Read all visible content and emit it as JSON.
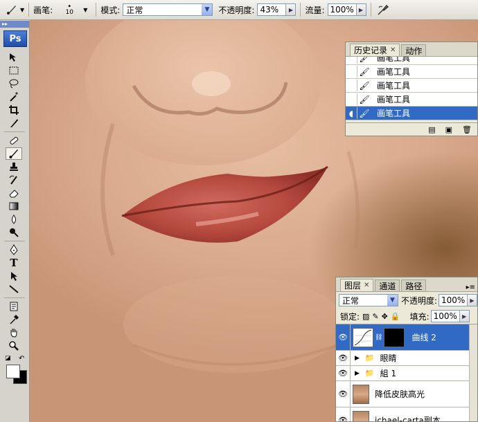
{
  "options_bar": {
    "brush_label": "画笔:",
    "brush_size": "10",
    "mode_label": "模式:",
    "mode_value": "正常",
    "opacity_label": "不透明度:",
    "opacity_value": "43%",
    "flow_label": "流量:",
    "flow_value": "100%"
  },
  "toolbox": {
    "logo": "Ps",
    "text_tool": "T"
  },
  "history_panel": {
    "tabs": [
      "历史记录",
      "动作"
    ],
    "items": [
      {
        "label": "画笔工具",
        "selected": false
      },
      {
        "label": "画笔工具",
        "selected": false
      },
      {
        "label": "画笔工具",
        "selected": false
      },
      {
        "label": "画笔工具",
        "selected": false
      },
      {
        "label": "画笔工具",
        "selected": true
      }
    ]
  },
  "layers_panel": {
    "tabs": [
      "图层",
      "通道",
      "路径"
    ],
    "blend_mode": "正常",
    "opacity_label": "不透明度:",
    "opacity_value": "100%",
    "lock_label": "锁定:",
    "fill_label": "填充:",
    "fill_value": "100%",
    "layers": [
      {
        "name": "曲线 2",
        "kind": "adjustment",
        "selected": true
      },
      {
        "name": "眼睛",
        "kind": "group",
        "selected": false
      },
      {
        "name": "組 1",
        "kind": "group",
        "selected": false
      },
      {
        "name": "降低皮肤高光",
        "kind": "pixel",
        "selected": false
      },
      {
        "name": "ichael-carta副本",
        "kind": "pixel",
        "selected": false
      }
    ]
  },
  "colors": {
    "selection": "#316ac5",
    "panel_bg": "#ece9d8",
    "lip": "#b5493e",
    "skin": "#dcae90"
  }
}
